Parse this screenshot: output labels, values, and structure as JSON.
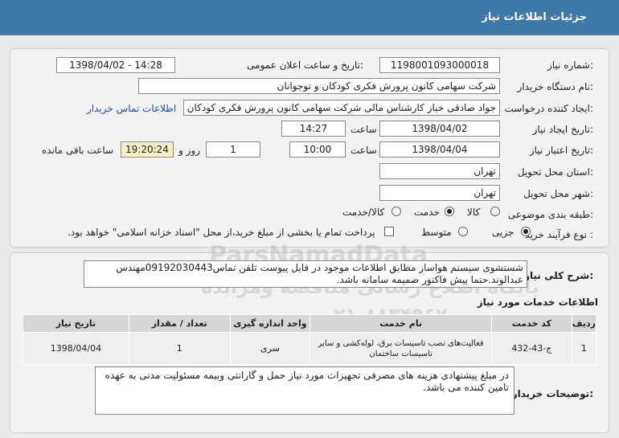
{
  "header": {
    "title": "جزئیات اطلاعات نیاز"
  },
  "form": {
    "need_number_label": "شماره نیاز:",
    "need_number": "1198001093000018",
    "announce_label": "تاریخ و ساعت اعلان عمومی:",
    "announce_value": "1398/04/02 - 14:28",
    "buyer_org_label": "نام دستگاه خریدار:",
    "buyer_org": "شرکت سهامی کانون پرورش فکری کودکان و نوجوانان",
    "creator_label": "ایجاد کننده درخواست:",
    "creator": "جواد  صادقی خباز کارشناس مالی شرکت سهامی کانون پرورش فکری کودکان",
    "contact_link": "اطلاعات تماس خریدار",
    "created_date_label": "تاریخ ایجاد نیاز:",
    "created_date": "1398/04/02",
    "time_word": "ساعت",
    "created_time": "14:27",
    "validity_label": "تاریخ اعتبار نیاز:",
    "validity_date": "1398/04/04",
    "validity_time": "10:00",
    "days": "1",
    "days_word": "روز و",
    "remaining_time": "19:20:24",
    "remaining_label": "ساعت باقی مانده",
    "province_label": "استان محل تحویل:",
    "province": "تهران",
    "city_label": "شهر محل تحویل:",
    "city": "تهران",
    "category_label": "طبقه بندی موضوعی:",
    "category_options": [
      "کالا",
      "خدمت",
      "کالا/خدمت"
    ],
    "purchase_type_label": "نوع فرآیند خرید :",
    "purchase_options": [
      "جزیی",
      "متوسط"
    ],
    "payment_note": "پرداخت تمام یا بخشی از مبلغ خرید،از محل \"اسناد خزانه اسلامی\" خواهد بود."
  },
  "description": {
    "label": "شرح کلی نیاز:",
    "text": "شستشوی سیستم هواساز مطابق اطلاعات موجود در فایل پیوست تلفن تماس09192030443مهندس عبدالوند.حتما پیش فاکتور ضمیمه سامانه باشد."
  },
  "services": {
    "title": "اطلاعات خدمات مورد نیاز",
    "columns": [
      "ردیف",
      "کد خدمت",
      "نام خدمت",
      "واحد اندازه گیری",
      "تعداد / مقدار",
      "تاریخ نیاز"
    ],
    "rows": [
      [
        "1",
        "ج-43-432",
        "فعالیت‌های نصب تاسیسات برق، لوله‌کشی و سایر تاسیسات ساختمان",
        "سری",
        "1",
        "1398/04/04"
      ]
    ]
  },
  "buyer_notes": {
    "label": "توضیحات خریدار:",
    "text": "در مبلغ پیشنهادی هزینه های مصرفی تجهیزات مورد نیاز حمل و گارانتی وبیمه مسئولیت مدنی به عهده تامین کننده می باشد."
  },
  "watermark": {
    "line1": "ParsNamadData",
    "line2": "پایگاه اطلاع رسانی مناقصه ومزایده",
    "line3": "۰۲۱-۸۸۳۴۹۶۷۰"
  },
  "colors": {
    "header_bg": "#3f79a8",
    "link": "#1a4fb3",
    "highlight": "#f4f1c7"
  }
}
